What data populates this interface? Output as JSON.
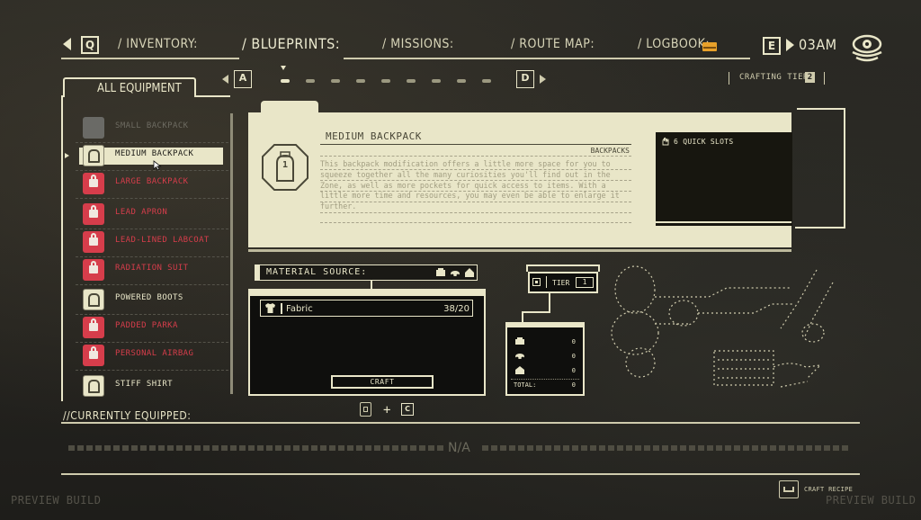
{
  "nav": {
    "prev_key": "Q",
    "next_key": "E",
    "tabs": [
      "/ INVENTORY:",
      "/ BLUEPRINTS:",
      "/ MISSIONS:",
      "/ ROUTE MAP:",
      "/ LOGBOOK:"
    ],
    "active_tab": "/ BLUEPRINTS:",
    "time": "03AM"
  },
  "subnav": {
    "left_key": "A",
    "right_key": "D",
    "crafting_tier_label": "CRAFTING TIER",
    "crafting_tier_value": "2",
    "page_count": 9,
    "active_page": 1
  },
  "category": {
    "title": "ALL EQUIPMENT"
  },
  "equipment": [
    {
      "label": "SMALL BACKPACK",
      "state": "crafted"
    },
    {
      "label": "MEDIUM BACKPACK",
      "state": "selected"
    },
    {
      "label": "LARGE BACKPACK",
      "state": "locked"
    },
    {
      "label": "LEAD APRON",
      "state": "locked"
    },
    {
      "label": "LEAD-LINED LABCOAT",
      "state": "locked"
    },
    {
      "label": "RADIATION SUIT",
      "state": "locked"
    },
    {
      "label": "POWERED BOOTS",
      "state": "available"
    },
    {
      "label": "PADDED PARKA",
      "state": "locked"
    },
    {
      "label": "PERSONAL AIRBAG",
      "state": "locked"
    },
    {
      "label": "STIFF SHIRT",
      "state": "available"
    }
  ],
  "detail": {
    "title": "MEDIUM BACKPACK",
    "category": "BACKPACKS",
    "icon_number": "1",
    "description": "This backpack modification offers a little more space for you to squeeze together all the many curiosities you'll find out in the Zone, as well as more pockets for quick access to items. With a little more time and resources, you may even be able to enlarge it further.",
    "stat": "6 QUICK SLOTS"
  },
  "material": {
    "header": "MATERIAL SOURCE:",
    "items": [
      {
        "name": "Fabric",
        "amount": "38/20"
      }
    ],
    "craft_button": "CRAFT"
  },
  "tier": {
    "label": "TIER",
    "value": "1"
  },
  "sources": {
    "rows": [
      "0",
      "0",
      "0"
    ],
    "total_label": "TOTAL:",
    "total_value": "0"
  },
  "combo": {
    "plus": "+",
    "right_key": "C"
  },
  "equipped": {
    "header": "//CURRENTLY EQUIPPED:",
    "value": "N/A"
  },
  "footer": {
    "watermark_left": "PREVIEW BUILD",
    "watermark_right": "PREVIEW BUILD",
    "craft_recipe": "CRAFT RECIPE"
  },
  "colors": {
    "cream": "#e9e6c8",
    "locked_red": "#d63d4b",
    "background": "#24231f"
  }
}
